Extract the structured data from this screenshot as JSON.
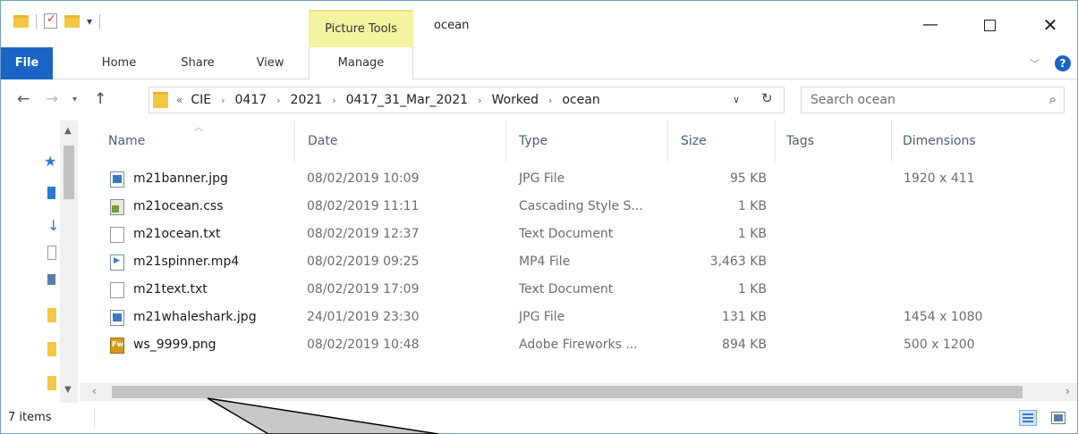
{
  "titlebar": {
    "context_tab": "Picture Tools",
    "title": "ocean",
    "minimize_glyph": "—",
    "close_glyph": "✕"
  },
  "ribbon": {
    "tabs": [
      {
        "label": "File"
      },
      {
        "label": "Home"
      },
      {
        "label": "Share"
      },
      {
        "label": "View"
      },
      {
        "label": "Manage"
      }
    ],
    "help_glyph": "?"
  },
  "address": {
    "overflow": "«",
    "crumbs": [
      "CIE",
      "0417",
      "2021",
      "0417_31_Mar_2021",
      "Worked",
      "ocean"
    ]
  },
  "search": {
    "placeholder": "Search ocean"
  },
  "columns": {
    "name": "Name",
    "date": "Date",
    "type": "Type",
    "size": "Size",
    "tags": "Tags",
    "dimensions": "Dimensions"
  },
  "files": [
    {
      "name": "m21banner.jpg",
      "date": "08/02/2019 10:09",
      "type": "JPG File",
      "size": "95 KB",
      "dimensions": "1920 x 411",
      "icon": "jpg-file-icon"
    },
    {
      "name": "m21ocean.css",
      "date": "08/02/2019 11:11",
      "type": "Cascading Style S...",
      "size": "1 KB",
      "dimensions": "",
      "icon": "css-file-icon"
    },
    {
      "name": "m21ocean.txt",
      "date": "08/02/2019 12:37",
      "type": "Text Document",
      "size": "1 KB",
      "dimensions": "",
      "icon": "text-file-icon"
    },
    {
      "name": "m21spinner.mp4",
      "date": "08/02/2019 09:25",
      "type": "MP4 File",
      "size": "3,463 KB",
      "dimensions": "",
      "icon": "video-file-icon"
    },
    {
      "name": "m21text.txt",
      "date": "08/02/2019 17:09",
      "type": "Text Document",
      "size": "1 KB",
      "dimensions": "",
      "icon": "text-file-icon"
    },
    {
      "name": "m21whaleshark.jpg",
      "date": "24/01/2019 23:30",
      "type": "JPG File",
      "size": "131 KB",
      "dimensions": "1454 x 1080",
      "icon": "jpg-file-icon"
    },
    {
      "name": "ws_9999.png",
      "date": "08/02/2019 10:48",
      "type": "Adobe Fireworks ...",
      "size": "894 KB",
      "dimensions": "500 x 1200",
      "icon": "fireworks-file-icon"
    }
  ],
  "status": {
    "item_count": "7 items"
  },
  "colors": {
    "file_tab": "#1a65c4",
    "picture_tools": "#f5f3a0",
    "header_text": "#4c607a",
    "callout_fill": "#c8c8c8"
  }
}
